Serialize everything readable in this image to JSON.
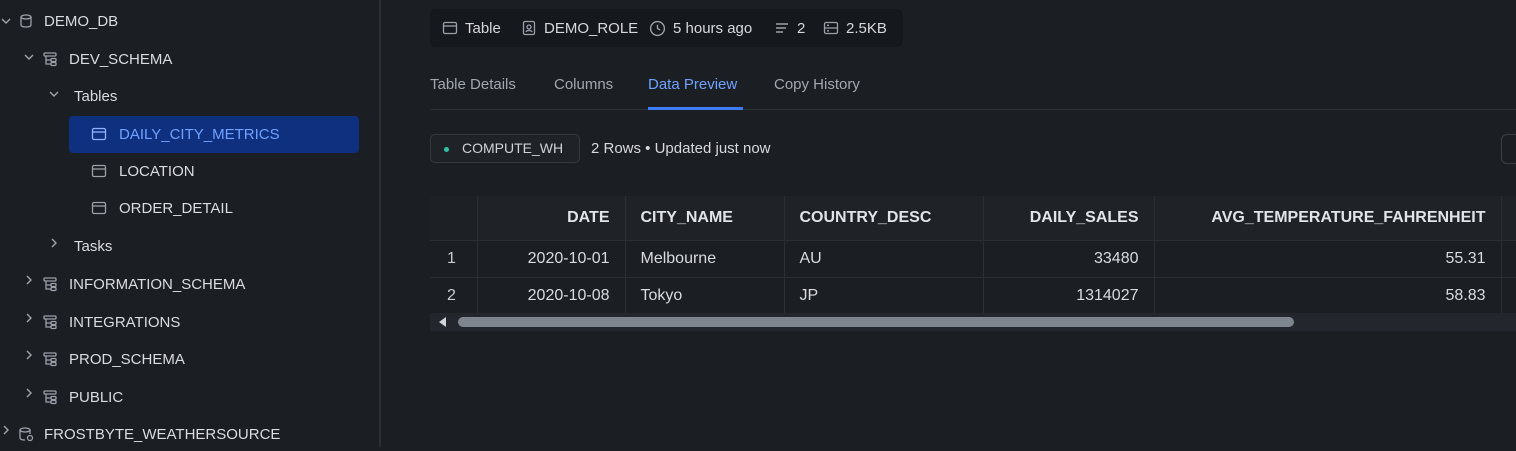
{
  "sidebar": {
    "database": "DEMO_DB",
    "dev_schema": "DEV_SCHEMA",
    "tables_group": "Tables",
    "tables": [
      "DAILY_CITY_METRICS",
      "LOCATION",
      "ORDER_DETAIL"
    ],
    "tasks_group": "Tasks",
    "schemas": [
      "INFORMATION_SCHEMA",
      "INTEGRATIONS",
      "PROD_SCHEMA",
      "PUBLIC"
    ],
    "other_database": "FROSTBYTE_WEATHERSOURCE"
  },
  "info": {
    "type": "Table",
    "role": "DEMO_ROLE",
    "updated": "5 hours ago",
    "rows": "2",
    "size": "2.5KB"
  },
  "tabs": [
    {
      "label": "Table Details",
      "active": false
    },
    {
      "label": "Columns",
      "active": false
    },
    {
      "label": "Data Preview",
      "active": true
    },
    {
      "label": "Copy History",
      "active": false
    }
  ],
  "preview": {
    "warehouse": "COMPUTE_WH",
    "row_info": "2 Rows • Updated just now"
  },
  "table": {
    "headers": [
      "DATE",
      "CITY_NAME",
      "COUNTRY_DESC",
      "DAILY_SALES",
      "AVG_TEMPERATURE_FAHRENHEIT"
    ],
    "rows": [
      [
        "1",
        "2020-10-01",
        "Melbourne",
        "AU",
        "33480",
        "55.31"
      ],
      [
        "2",
        "2020-10-08",
        "Tokyo",
        "JP",
        "1314027",
        "58.83"
      ]
    ]
  },
  "colors": {
    "accent": "#6fa2ff",
    "selected_bg": "#0f2f7f",
    "warehouse_status": "#2fc3a5"
  }
}
